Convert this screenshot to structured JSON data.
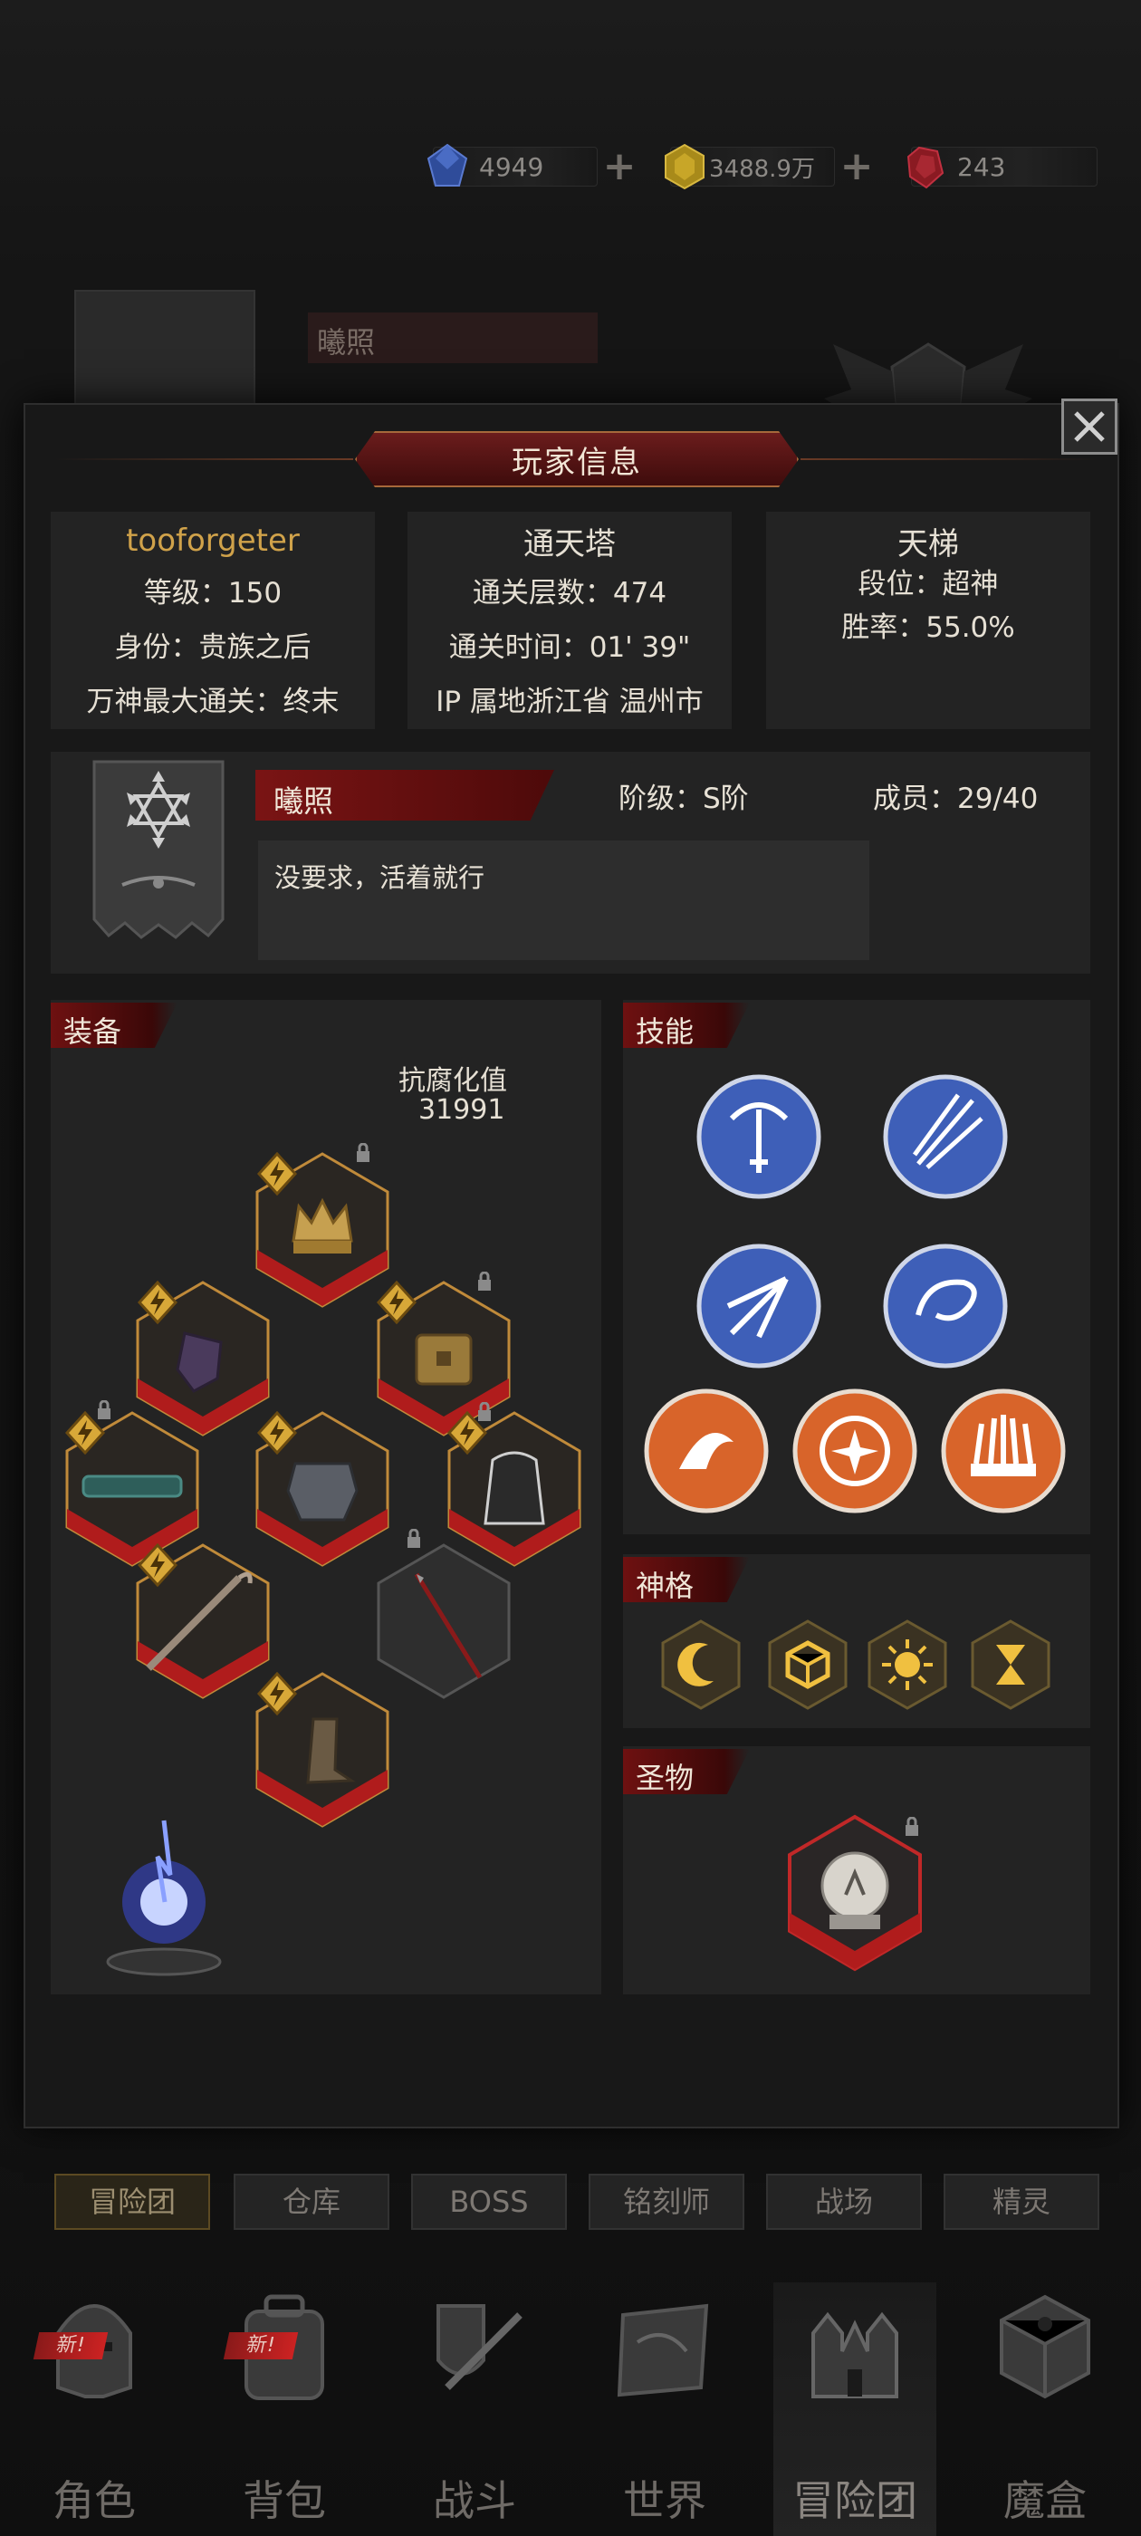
{
  "resources": {
    "diamond": "4949",
    "gold": "3488.9万",
    "ruby": "243"
  },
  "background": {
    "guild_name": "曦照"
  },
  "modal": {
    "title": "玩家信息"
  },
  "player": {
    "name": "tooforgeter",
    "level": "等级：150",
    "identity": "身份：贵族之后",
    "pantheon_max": "万神最大通关：终末"
  },
  "tower": {
    "title": "通天塔",
    "floors": "通关层数：474",
    "time": "通关时间：01' 39\"",
    "ip": "IP 属地浙江省 温州市"
  },
  "ladder": {
    "title": "天梯",
    "rank": "段位：超神",
    "winrate": "胜率：55.0%"
  },
  "guild": {
    "name": "曦照",
    "tier": "阶级：S阶",
    "members": "成员：29/40",
    "notice": "没要求，活着就行"
  },
  "equipment": {
    "label": "装备",
    "corruption_label": "抗腐化值",
    "corruption_value": "31991"
  },
  "skills": {
    "label": "技能"
  },
  "divinity": {
    "label": "神格"
  },
  "relic": {
    "label": "圣物"
  },
  "subtabs": [
    "冒险团",
    "仓库",
    "BOSS",
    "铭刻师",
    "战场",
    "精灵"
  ],
  "nav": {
    "items": [
      "角色",
      "背包",
      "战斗",
      "世界",
      "冒险团",
      "魔盒"
    ],
    "new_badge": "新!"
  },
  "colors": {
    "accent_red": "#7a1414",
    "gold": "#e0b040",
    "skill_blue": "#3e5fb8",
    "skill_orange": "#d8642a"
  }
}
